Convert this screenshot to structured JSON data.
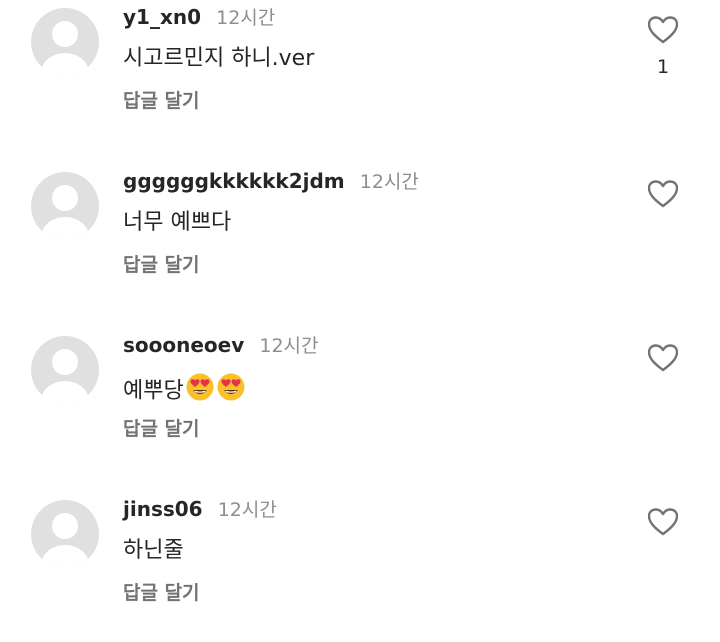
{
  "comments": [
    {
      "username": "y1_xn0",
      "time": "12시간",
      "text": "시고르민지 하니.ver",
      "reply_label": "답글 달기",
      "like_count": "1",
      "icons": [
        "avatar-placeholder",
        "heart-outline-icon"
      ]
    },
    {
      "username": "ggggggkkkkkk2jdm",
      "time": "12시간",
      "text": "너무 예쁘다",
      "reply_label": "답글 달기",
      "icons": [
        "avatar-placeholder",
        "heart-outline-icon"
      ]
    },
    {
      "username": "soooneoev",
      "time": "12시간",
      "text": "예뿌당",
      "emoji": [
        "heart-eyes-emoji",
        "heart-eyes-emoji"
      ],
      "reply_label": "답글 달기",
      "icons": [
        "avatar-placeholder",
        "heart-outline-icon"
      ]
    },
    {
      "username": "jinss06",
      "time": "12시간",
      "text": "하닌줄",
      "reply_label": "답글 달기",
      "icons": [
        "avatar-placeholder",
        "heart-outline-icon"
      ]
    }
  ],
  "colors": {
    "username": "#262626",
    "secondary_text": "#8e8e8e",
    "reply_text": "#737373",
    "avatar_bg": "#e0e0e0",
    "heart_stroke": "#737373",
    "emoji_face": "#f9c02a",
    "emoji_heart": "#e8304a"
  }
}
